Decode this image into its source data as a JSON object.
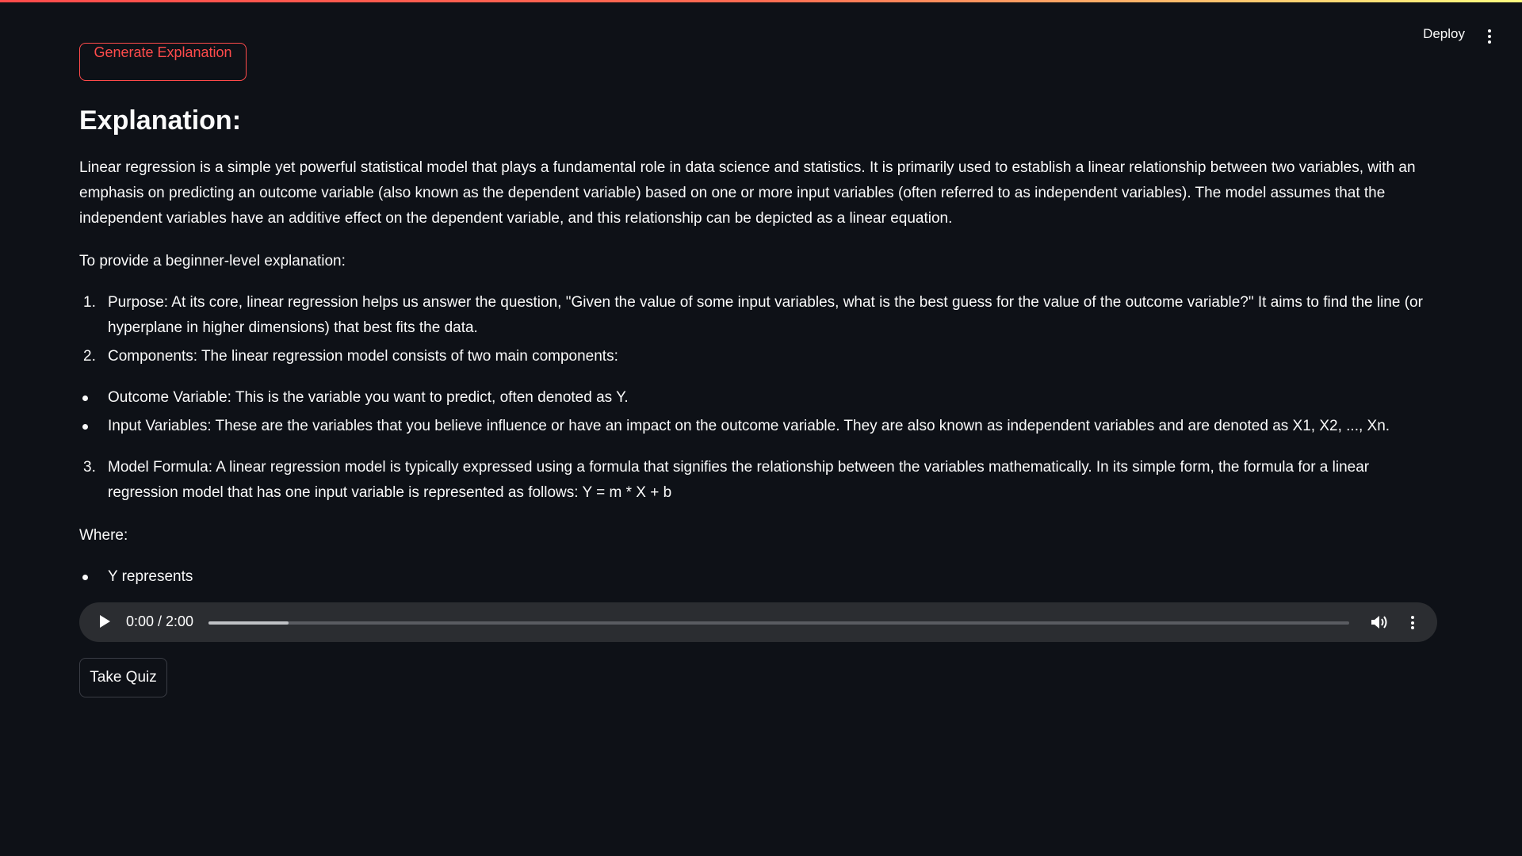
{
  "header": {
    "deploy_label": "Deploy",
    "menu_icon": "kebab-menu-icon"
  },
  "main": {
    "generate_button_label": "Generate Explanation",
    "title": "Explanation:",
    "intro": "Linear regression is a simple yet powerful statistical model that plays a fundamental role in data science and statistics. It is primarily used to establish a linear relationship between two variables, with an emphasis on predicting an outcome variable (also known as the dependent variable) based on one or more input variables (often referred to as independent variables). The model assumes that the independent variables have an additive effect on the dependent variable, and this relationship can be depicted as a linear equation.",
    "subintro": "To provide a beginner-level explanation:",
    "items": [
      {
        "num": "1.",
        "text": "Purpose: At its core, linear regression helps us answer the question, \"Given the value of some input variables, what is the best guess for the value of the outcome variable?\" It aims to find the line (or hyperplane in higher dimensions) that best fits the data."
      },
      {
        "num": "2.",
        "text": "Components: The linear regression model consists of two main components:"
      },
      {
        "num": "3.",
        "text": "Model Formula: A linear regression model is typically expressed using a formula that signifies the relationship between the variables mathematically. In its simple form, the formula for a linear regression model that has one input variable is represented as follows: Y = m * X + b"
      }
    ],
    "bullets": [
      "Outcome Variable: This is the variable you want to predict, often denoted as Y.",
      "Input Variables: These are the variables that you believe influence or have an impact on the outcome variable. They are also known as independent variables and are denoted as X1, X2, ..., Xn."
    ],
    "where_label": "Where:",
    "where_bullets": [
      "Y represents"
    ]
  },
  "audio": {
    "time": "0:00 / 2:00",
    "buffered_fraction": 0.07,
    "play_icon": "play-icon",
    "volume_icon": "volume-icon",
    "menu_icon": "kebab-menu-icon"
  },
  "quiz_button_label": "Take Quiz"
}
